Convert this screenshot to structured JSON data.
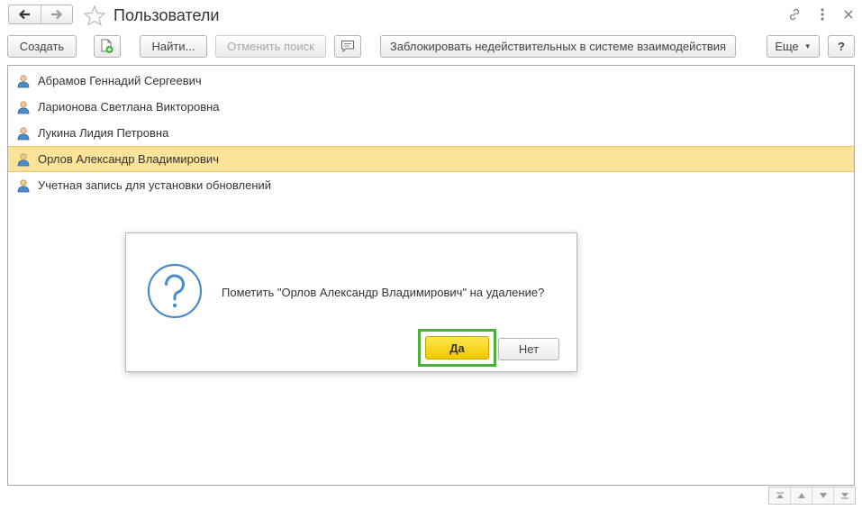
{
  "window": {
    "title": "Пользователи"
  },
  "toolbar": {
    "create_label": "Создать",
    "find_label": "Найти...",
    "cancel_search_label": "Отменить поиск",
    "block_label": "Заблокировать недействительных в системе взаимодействия",
    "more_label": "Еще",
    "help_label": "?"
  },
  "users": [
    {
      "name": "Абрамов Геннадий Сергеевич",
      "selected": false
    },
    {
      "name": "Ларионова Светлана Викторовна",
      "selected": false
    },
    {
      "name": "Лукина Лидия Петровна",
      "selected": false
    },
    {
      "name": "Орлов Александр Владимирович",
      "selected": true
    },
    {
      "name": "Учетная запись для установки обновлений",
      "selected": false
    }
  ],
  "dialog": {
    "message": "Пометить \"Орлов Александр Владимирович\" на удаление?",
    "yes_label": "Да",
    "no_label": "Нет"
  },
  "colors": {
    "selection": "#fbe39a",
    "default_button": "#f5d420",
    "highlight_frame": "#4caf3b",
    "icon_blue": "#4a8cc9"
  },
  "icons": {
    "back": "arrow-left-icon",
    "forward": "arrow-right-icon",
    "favorite": "star-icon",
    "link": "link-icon",
    "menu": "vertical-dots-icon",
    "close": "close-icon",
    "add_copy": "document-plus-icon",
    "comment": "speech-bubble-icon",
    "user": "user-icon",
    "question": "question-icon"
  }
}
